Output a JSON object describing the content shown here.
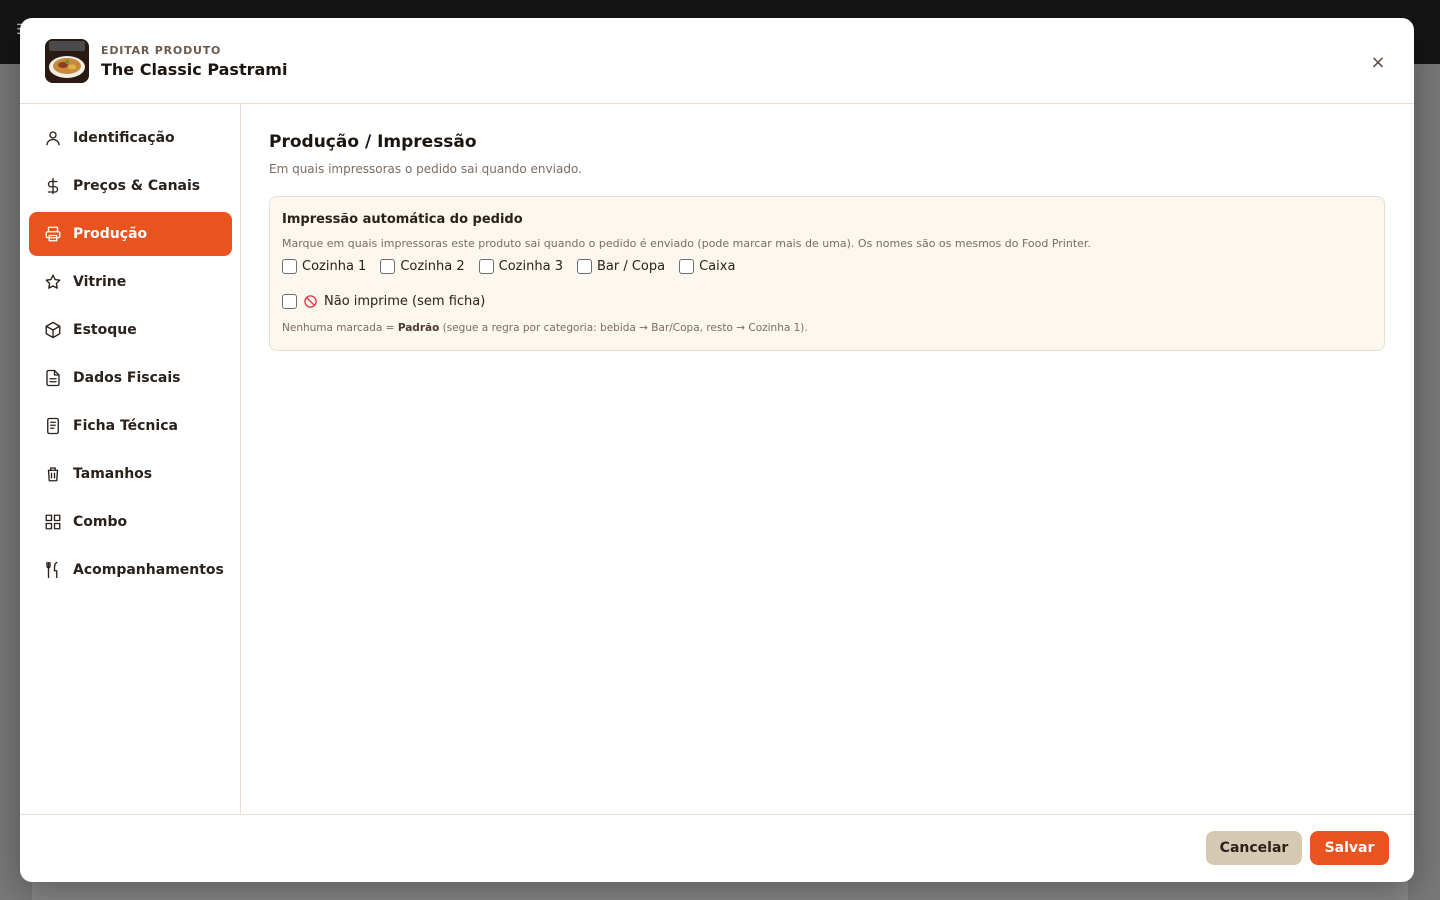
{
  "header": {
    "kicker": "EDITAR PRODUTO",
    "title": "The Classic Pastrami",
    "close_label": "×"
  },
  "sidebar": {
    "items": [
      {
        "label": "Identificação",
        "icon": "user-icon",
        "active": false
      },
      {
        "label": "Preços & Canais",
        "icon": "dollar-icon",
        "active": false
      },
      {
        "label": "Produção",
        "icon": "printer-icon",
        "active": true
      },
      {
        "label": "Vitrine",
        "icon": "star-icon",
        "active": false
      },
      {
        "label": "Estoque",
        "icon": "box-icon",
        "active": false
      },
      {
        "label": "Dados Fiscais",
        "icon": "document-icon",
        "active": false
      },
      {
        "label": "Ficha Técnica",
        "icon": "receipt-icon",
        "active": false
      },
      {
        "label": "Tamanhos",
        "icon": "cup-icon",
        "active": false
      },
      {
        "label": "Combo",
        "icon": "grid-icon",
        "active": false
      },
      {
        "label": "Acompanhamentos",
        "icon": "utensils-icon",
        "active": false
      }
    ]
  },
  "main": {
    "title": "Produção / Impressão",
    "subtitle": "Em quais impressoras o pedido sai quando enviado.",
    "card": {
      "title": "Impressão automática do pedido",
      "description": "Marque em quais impressoras este produto sai quando o pedido é enviado (pode marcar mais de uma). Os nomes são os mesmos do Food Printer.",
      "printers": [
        {
          "label": "Cozinha 1",
          "checked": false
        },
        {
          "label": "Cozinha 2",
          "checked": false
        },
        {
          "label": "Cozinha 3",
          "checked": false
        },
        {
          "label": "Bar / Copa",
          "checked": false
        },
        {
          "label": "Caixa",
          "checked": false
        }
      ],
      "no_print_label": "Não imprime (sem ficha)",
      "footnote_prefix": "Nenhuma marcada = ",
      "footnote_bold": "Padrão",
      "footnote_suffix": " (segue a regra por categoria: bebida → Bar/Copa, resto → Cozinha 1)."
    }
  },
  "footer": {
    "cancel_label": "Cancelar",
    "save_label": "Salvar"
  },
  "colors": {
    "accent": "#e8531f",
    "cancel_bg": "#d6c9b2",
    "card_bg": "#fcf7ef"
  }
}
